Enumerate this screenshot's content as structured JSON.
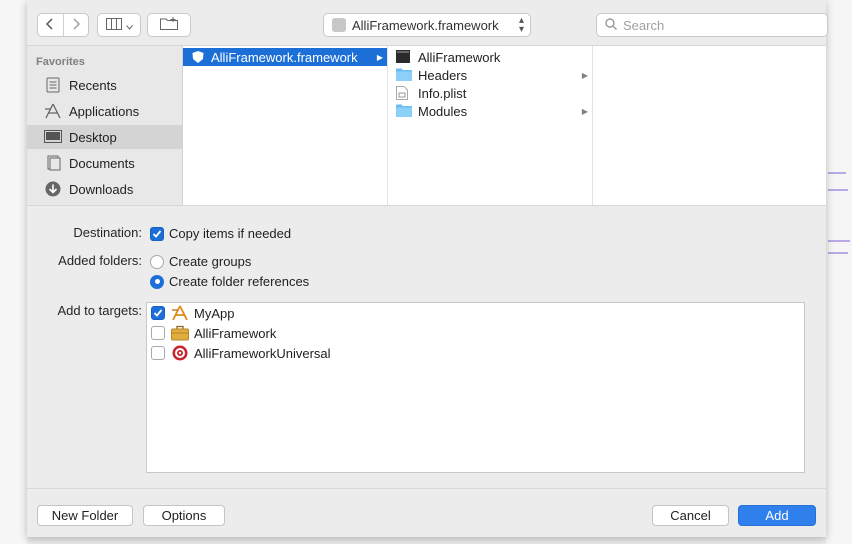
{
  "toolbar": {
    "path_label": "AlliFramework.framework",
    "search_placeholder": "Search"
  },
  "sidebar": {
    "heading": "Favorites",
    "items": [
      {
        "label": "Recents",
        "icon": "recents-icon"
      },
      {
        "label": "Applications",
        "icon": "applications-icon"
      },
      {
        "label": "Desktop",
        "icon": "desktop-icon",
        "selected": true
      },
      {
        "label": "Documents",
        "icon": "documents-icon"
      },
      {
        "label": "Downloads",
        "icon": "downloads-icon"
      }
    ]
  },
  "browser": {
    "column1": [
      {
        "label": "AlliFramework.framework",
        "selected": true
      }
    ],
    "column2": [
      {
        "label": "AlliFramework",
        "icon": "exec-icon"
      },
      {
        "label": "Headers",
        "icon": "folder-icon"
      },
      {
        "label": "Info.plist",
        "icon": "plist-icon"
      },
      {
        "label": "Modules",
        "icon": "folder-icon"
      }
    ]
  },
  "options": {
    "destination_label": "Destination:",
    "copy_items_label": "Copy items if needed",
    "copy_items_checked": true,
    "added_folders_label": "Added folders:",
    "create_groups_label": "Create groups",
    "create_folder_refs_label": "Create folder references",
    "selected_folder_option": "Create folder references",
    "targets_label": "Add to targets:"
  },
  "targets": [
    {
      "label": "MyApp",
      "checked": true,
      "icon": "app-icon"
    },
    {
      "label": "AlliFramework",
      "checked": false,
      "icon": "toolbox-icon"
    },
    {
      "label": "AlliFrameworkUniversal",
      "checked": false,
      "icon": "target-icon"
    }
  ],
  "footer": {
    "new_folder": "New Folder",
    "options": "Options",
    "cancel": "Cancel",
    "add": "Add"
  },
  "colors": {
    "accent": "#1d6fd8",
    "primary_button": "#2f80ec"
  }
}
